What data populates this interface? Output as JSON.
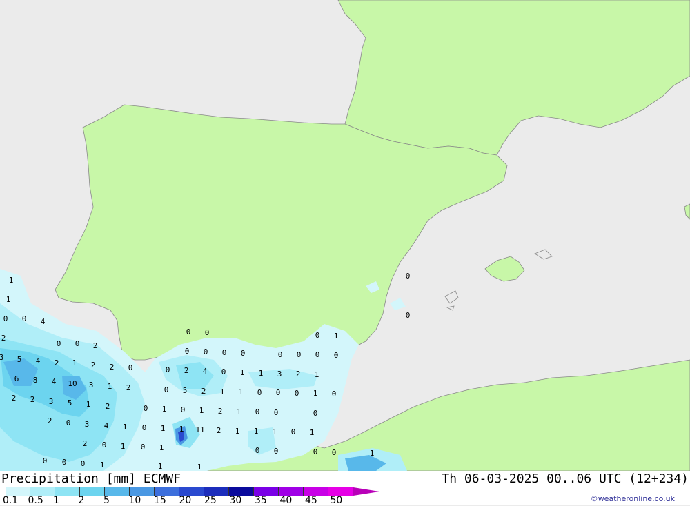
{
  "title_left": "Precipitation [mm] ECMWF",
  "title_right": "Th 06-03-2025 00..06 UTC (12+234)",
  "credit": "©weatheronline.co.uk",
  "legend": {
    "labels": [
      "0.1",
      "0.5",
      "1",
      "2",
      "5",
      "10",
      "15",
      "20",
      "25",
      "30",
      "35",
      "40",
      "45",
      "50"
    ],
    "colors": [
      "#d3f6fb",
      "#b0eef8",
      "#8ee4f4",
      "#6cd4ef",
      "#58b8ea",
      "#4a98e3",
      "#3d6fdc",
      "#2a49cf",
      "#1c2dbc",
      "#0a0a9c",
      "#7a00e6",
      "#a000e6",
      "#c800e6",
      "#e600e6",
      "#b800b8"
    ]
  },
  "colors": {
    "sea": "#ebebeb",
    "land": "#c8f7a8",
    "border": "#8a8a8a"
  },
  "precip_values": [
    "1",
    "1",
    "0",
    "0",
    "4",
    "2",
    "0",
    "0",
    "2",
    "3",
    "5",
    "4",
    "2",
    "1",
    "2",
    "2",
    "0",
    "6",
    "8",
    "4",
    "10",
    "3",
    "1",
    "2",
    "2",
    "2",
    "3",
    "5",
    "1",
    "2",
    "2",
    "0",
    "3",
    "4",
    "1",
    "2",
    "0",
    "1",
    "0",
    "0",
    "0",
    "1",
    "0",
    "0",
    "0",
    "0",
    "0",
    "0",
    "0",
    "0",
    "0",
    "0",
    "0",
    "1",
    "0",
    "2",
    "4",
    "0",
    "1",
    "1",
    "3",
    "2",
    "1",
    "0",
    "5",
    "2",
    "1",
    "1",
    "0",
    "0",
    "0",
    "1",
    "0",
    "0",
    "1",
    "0",
    "1",
    "2",
    "1",
    "0",
    "0",
    "0",
    "0",
    "1",
    "1",
    "11",
    "2",
    "1",
    "1",
    "1",
    "0",
    "1",
    "0",
    "1",
    "0",
    "0",
    "0",
    "0",
    "1",
    "0",
    "0",
    "1",
    "1"
  ]
}
